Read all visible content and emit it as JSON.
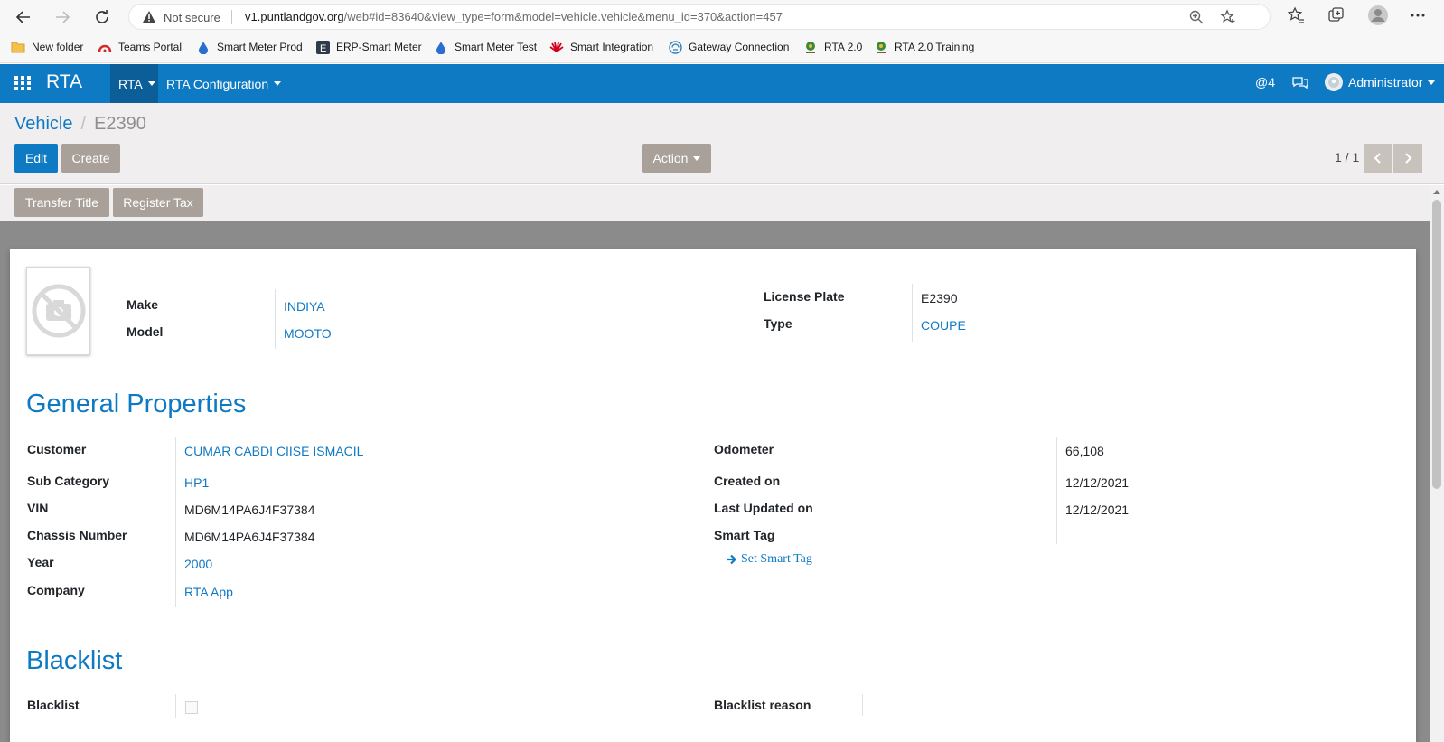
{
  "browser": {
    "not_secure": "Not secure",
    "url_host": "v1.puntlandgov.org",
    "url_path": "/web#id=83640&view_type=form&model=vehicle.vehicle&menu_id=370&action=457"
  },
  "bookmarks": [
    {
      "label": "New folder",
      "icon": "folder-icon"
    },
    {
      "label": "Teams Portal",
      "icon": "teams-icon"
    },
    {
      "label": "Smart Meter Prod",
      "icon": "drop-icon"
    },
    {
      "label": "ERP-Smart Meter",
      "icon": "e-icon"
    },
    {
      "label": "Smart Meter Test",
      "icon": "drop-icon"
    },
    {
      "label": "Smart Integration",
      "icon": "huawei-icon"
    },
    {
      "label": "Gateway Connection",
      "icon": "gateway-icon"
    },
    {
      "label": "RTA 2.0",
      "icon": "emblem-icon"
    },
    {
      "label": "RTA 2.0 Training",
      "icon": "emblem-icon"
    }
  ],
  "navbar": {
    "brand": "RTA",
    "menu_rta": "RTA",
    "menu_config": "RTA Configuration",
    "mentions": "@4",
    "user": "Administrator"
  },
  "control_panel": {
    "breadcrumb_parent": "Vehicle",
    "breadcrumb_current": "E2390",
    "edit": "Edit",
    "create": "Create",
    "action": "Action",
    "pager": "1 / 1"
  },
  "statusbar": {
    "transfer_title": "Transfer Title",
    "register_tax": "Register Tax"
  },
  "header_fields": {
    "make_label": "Make",
    "make_value": "INDIYA",
    "model_label": "Model",
    "model_value": "MOOTO",
    "plate_label": "License Plate",
    "plate_value": "E2390",
    "type_label": "Type",
    "type_value": "COUPE"
  },
  "general": {
    "title": "General Properties",
    "customer_label": "Customer",
    "customer_value": "CUMAR CABDI CIISE ISMACIL",
    "subcat_label": "Sub Category",
    "subcat_value": "HP1",
    "vin_label": "VIN",
    "vin_value": "MD6M14PA6J4F37384",
    "chassis_label": "Chassis Number",
    "chassis_value": "MD6M14PA6J4F37384",
    "year_label": "Year",
    "year_value": "2000",
    "company_label": "Company",
    "company_value": "RTA App",
    "odometer_label": "Odometer",
    "odometer_value": "66,108",
    "created_label": "Created on",
    "created_value": "12/12/2021",
    "updated_label": "Last Updated on",
    "updated_value": "12/12/2021",
    "smarttag_label": "Smart Tag",
    "set_smart_tag": "Set Smart Tag"
  },
  "blacklist": {
    "title": "Blacklist",
    "blacklist_label": "Blacklist",
    "reason_label": "Blacklist reason"
  }
}
